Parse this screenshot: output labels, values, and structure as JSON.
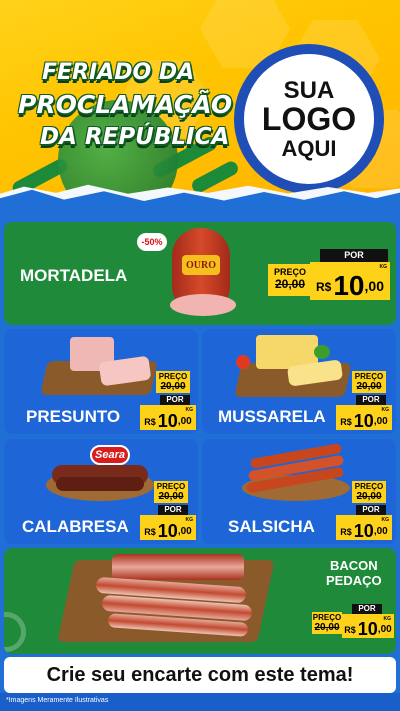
{
  "header": {
    "title_lines": [
      "FERIADO DA",
      "PROCLAMAÇÃO",
      "DA REPÚBLICA"
    ],
    "logo_lines": [
      "SUA",
      "LOGO",
      "AQUI"
    ]
  },
  "labels": {
    "preco": "PREÇO",
    "por": "POR",
    "currency": "R$",
    "kg": "KG"
  },
  "products": {
    "mortadela": {
      "name": "MORTADELA",
      "discount": "-50%",
      "brand": "OURO",
      "old_price": "20,00",
      "price_int": "10",
      "price_cents": ",00"
    },
    "presunto": {
      "name": "PRESUNTO",
      "old_price": "20,00",
      "price_int": "10",
      "price_cents": ",00"
    },
    "mussarela": {
      "name": "MUSSARELA",
      "old_price": "20,00",
      "price_int": "10",
      "price_cents": ",00"
    },
    "calabresa": {
      "name": "CALABRESA",
      "brand": "Seara",
      "old_price": "20,00",
      "price_int": "10",
      "price_cents": ",00"
    },
    "salsicha": {
      "name": "SALSICHA",
      "old_price": "20,00",
      "price_int": "10",
      "price_cents": ",00"
    },
    "bacon": {
      "name_line1": "BACON",
      "name_line2": "PEDAÇO",
      "old_price": "20,00",
      "price_int": "10",
      "price_cents": ",00"
    }
  },
  "banner": "Crie seu encarte com este tema!",
  "footnote": "*Imagens Meramente Ilustrativas",
  "colors": {
    "green": "#1f8a3a",
    "blue": "#1e66d8",
    "yellow": "#ffd21a"
  }
}
